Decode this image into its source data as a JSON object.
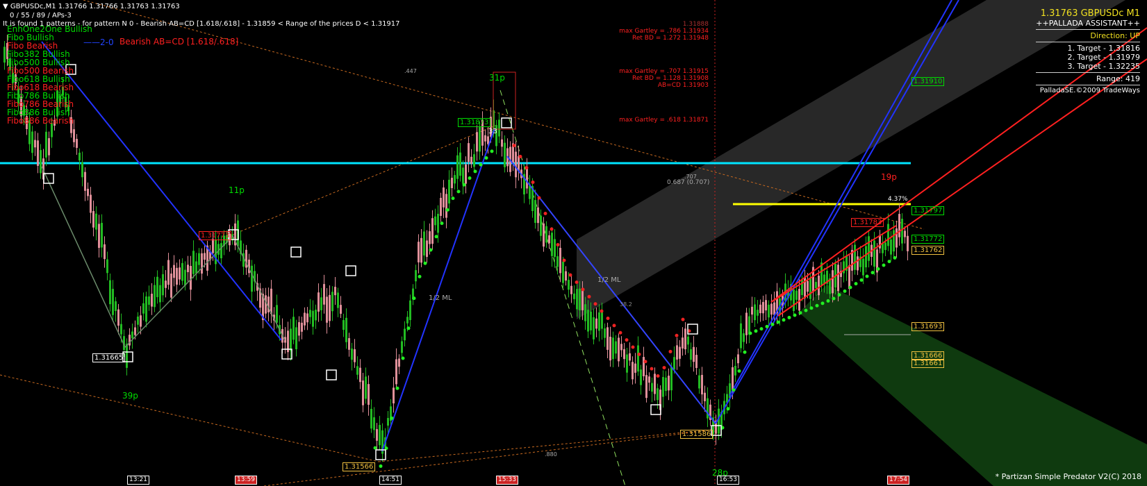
{
  "header": {
    "symbol_line": "GBPUSDc,M1  1.31766 1.31766 1.31763 1.31763",
    "params_line": "0 / 55 / 89 / APs-3",
    "pattern_line": "It is found 1 patterns -  for pattern N 0 - Bearish AB=CD [1.618/.618] - 1.31859 < Range of the prices D < 1.31917"
  },
  "legend": [
    {
      "label": "EnhOne2One Bullish",
      "color": "#00dd00"
    },
    {
      "label": "Fibo Bullish",
      "color": "#00dd00"
    },
    {
      "label": "Fibo Bearish",
      "color": "#ff2020"
    },
    {
      "label": "Fibo382 Bullish",
      "color": "#00dd00"
    },
    {
      "label": "Fibo500 Bullish",
      "color": "#00dd00"
    },
    {
      "label": "Fibo500 Bearish",
      "color": "#ff2020"
    },
    {
      "label": "Fibo618 Bullish",
      "color": "#00dd00"
    },
    {
      "label": "Fibo618 Bearish",
      "color": "#ff2020"
    },
    {
      "label": "Fibo786 Bullish",
      "color": "#00dd00"
    },
    {
      "label": "Fibo786 Bearish",
      "color": "#ff2020"
    },
    {
      "label": "Fibo886 Bullish",
      "color": "#00dd00"
    },
    {
      "label": "Fibo886 Bearish",
      "color": "#ff2020"
    }
  ],
  "pattern_tag": {
    "id": "2-0",
    "name": "Bearish AB=CD [1.618/.618]"
  },
  "info_panel": {
    "title": "1.31763 GBPUSDc M1",
    "subtitle": "++PALLADA ASSISTANT++",
    "direction": "Direction: UP",
    "targets": [
      "1. Target - 1.31816",
      "2. Target - 1.31979",
      "3. Target - 1.32235"
    ],
    "range": "Range: 419",
    "copyright": "PalladaSE.©2009 TradeWays"
  },
  "footer": "* Partizan Simple Predator V2(C) 2018",
  "gartley_notes": [
    {
      "lines": [
        "max Gartley = .786  1.31934",
        "Ret BD = 1.272  1.31948"
      ],
      "head": "1.31888"
    },
    {
      "lines": [
        "max Gartley = .707  1.31915",
        "Ret BD = 1.128  1.31908",
        "AB=CD  1.31903"
      ]
    },
    {
      "lines": [
        "max Gartley = .618  1.31871"
      ]
    }
  ],
  "misc_labels": {
    "ratio_447": ".447",
    "ratio_880": ".880",
    "ratio_707": ".707",
    "fib_0687": "0.687 (0.707)",
    "half_ml_1": "1/2 ML",
    "half_ml_2": "1/2 ML",
    "pct": "4.37%",
    "pips": [
      "11p",
      "39p",
      "31p",
      "19p",
      "28p"
    ],
    "fan_382": "38.2",
    "point_33": "33"
  },
  "chart_data": {
    "type": "candlestick",
    "symbol": "GBPUSDc",
    "timeframe": "M1",
    "ylim": [
      1.3154,
      1.3197
    ],
    "x_ticks": [
      {
        "label": "13:21",
        "color": "#000000"
      },
      {
        "label": "13:59",
        "color": "#cc2222"
      },
      {
        "label": "14:51",
        "color": "#000000"
      },
      {
        "label": "15:33",
        "color": "#cc2222"
      },
      {
        "label": "16:53",
        "color": "#000000"
      },
      {
        "label": "17:54",
        "color": "#cc2222"
      }
    ],
    "price_markers": [
      {
        "label": "1.31910",
        "color": "#00dd00"
      },
      {
        "label": "1.31797",
        "color": "#00dd00"
      },
      {
        "label": "1.31772",
        "color": "#00dd00"
      },
      {
        "label": "1.31762",
        "color": "#f0c040"
      },
      {
        "label": "1.31693",
        "color": "#f0c040"
      },
      {
        "label": "1.31666",
        "color": "#f0c040"
      },
      {
        "label": "1.31661",
        "color": "#f0c040"
      }
    ],
    "swing_labels": [
      {
        "label": "1.31665",
        "color": "#ffffff"
      },
      {
        "label": "1.31773",
        "color": "#ff2020"
      },
      {
        "label": "1.31566",
        "color": "#f0c040"
      },
      {
        "label": "1.31873",
        "color": "#00dd00"
      },
      {
        "label": "1.31783",
        "color": "#ff2020"
      },
      {
        "label": "1.31586",
        "color": "#f0c040"
      }
    ],
    "cyan_level": 1.3183,
    "yellow_level": 1.318
  }
}
